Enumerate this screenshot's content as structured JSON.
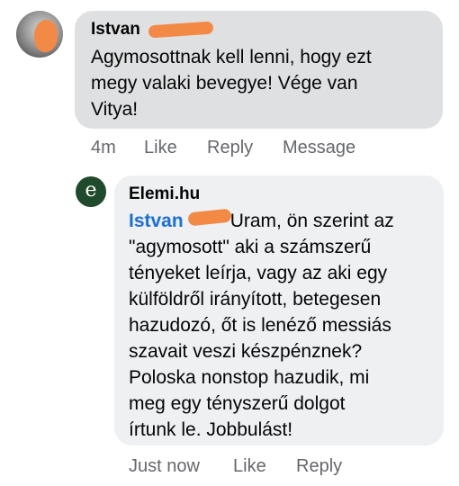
{
  "comment": {
    "author": "Istvan",
    "text_lines": [
      "Agymosottnak kell lenni, hogy ezt",
      "megy valaki bevegye! Vége van",
      "Vitya!"
    ],
    "actions": {
      "time": "4m",
      "like": "Like",
      "reply": "Reply",
      "message": "Message"
    }
  },
  "reply": {
    "author": "Elemi.hu",
    "avatar_glyph": "e",
    "mention": "Istvan",
    "text_first": "Uram, ön szerint az",
    "text_lines": [
      "\"agymosott\" aki a számszerű",
      "tényeket leírja, vagy az aki egy",
      "külföldről irányított, betegesen",
      "hazudozó, őt is lenéző messiás",
      "szavait veszi készpénznek?",
      "Poloska nonstop hazudik, mi",
      "meg egy tényszerű dolgot",
      "írtunk le. Jobbulást!"
    ],
    "actions": {
      "time": "Just now",
      "like": "Like",
      "reply": "Reply"
    }
  },
  "colors": {
    "bubble_grey": "#dfe0e2",
    "bubble_light": "#eef0f2",
    "mention_blue": "#1b6fd8",
    "meta_grey": "#65676b",
    "redaction_orange": "#f28a45",
    "page_avatar_green": "#1f4a2b"
  }
}
